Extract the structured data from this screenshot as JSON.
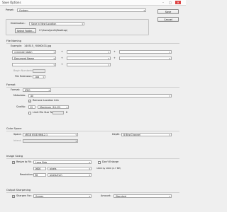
{
  "window": {
    "title": "Save Options",
    "minimize": "–",
    "maximize": "□",
    "close": "✕"
  },
  "preset": {
    "label": "Preset:",
    "value": "Custom"
  },
  "buttons": {
    "save": "Save",
    "cancel": "Cancel"
  },
  "destination": {
    "label": "Destination:",
    "value": "Save in New Location",
    "select_folder": "Select Folder...",
    "path": "C:\\Users\\Jenfe\\Desktop\\"
  },
  "file_naming": {
    "title": "File Naming",
    "example_label": "Example:",
    "example_value": "140515_ f0060431.jpg",
    "row1_left": "yymmdd (date)",
    "row1_sep": "+",
    "row2_left": "Document Name",
    "row2_sep": "+",
    "row3_sep": "+",
    "begin_numbering_label": "Begin Numbering:",
    "file_extension_label": "File Extension:",
    "file_extension_value": ".jpg"
  },
  "format": {
    "title": "Format",
    "format_label": "Format:",
    "format_value": "JPEG",
    "metadata_label": "Metadata:",
    "metadata_value": "All",
    "remove_location_label": "Remove Location Info",
    "quality_label": "Quality:",
    "quality_number": "12",
    "quality_value": "Maximum (10-12)",
    "limit_size_label": "Limit File Size To:",
    "limit_size_unit": "K"
  },
  "color_space": {
    "title": "Color Space",
    "space_label": "Space:",
    "space_value": "sRGB IEC61966-2.1",
    "depth_label": "Depth:",
    "depth_value": "8 Bits/Channel",
    "intent_label": "Intent:"
  },
  "image_sizing": {
    "title": "Image Sizing",
    "resize_label": "Resize to Fit:",
    "resize_value": "Long Side",
    "dont_enlarge_label": "Don't Enlarge",
    "size_value": "1600",
    "size_unit": "pixels",
    "dimensions_note": "1600 by 1600 (2.7 MP)",
    "resolution_label": "Resolution:",
    "resolution_value": "96",
    "resolution_unit": "pixels/inch"
  },
  "output_sharpening": {
    "title": "Output Sharpening",
    "sharpen_label": "Sharpen For:",
    "sharpen_value": "Screen",
    "amount_label": "Amount:",
    "amount_value": "Standard"
  }
}
